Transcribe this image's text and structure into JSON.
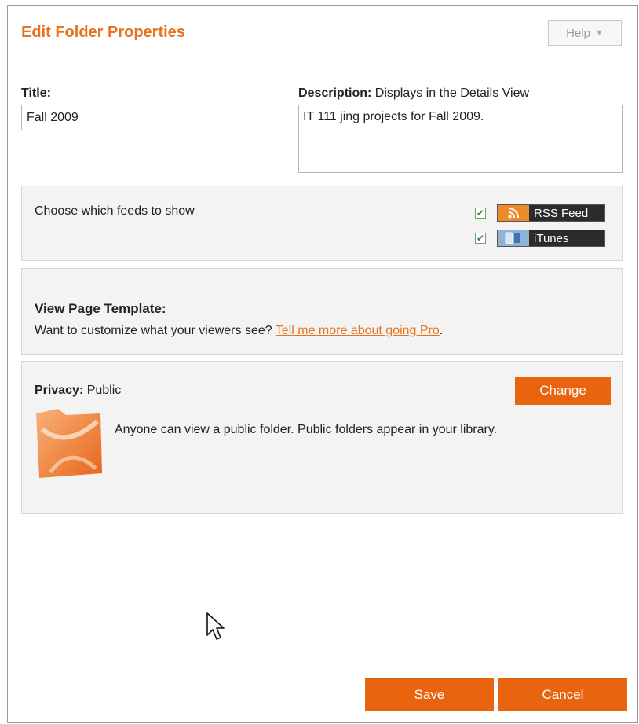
{
  "dialog": {
    "title": "Edit Folder Properties",
    "help_label": "Help"
  },
  "form": {
    "title_label": "Title:",
    "title_value": "Fall 2009",
    "description_label": "Description:",
    "description_hint": " Displays in the Details View",
    "description_value": "IT 111 jing projects for Fall 2009."
  },
  "feeds": {
    "prompt": "Choose which feeds to show",
    "items": [
      {
        "label": "RSS Feed",
        "checked": true,
        "icon": "rss-icon"
      },
      {
        "label": "iTunes",
        "checked": true,
        "icon": "itunes-icon"
      }
    ]
  },
  "template": {
    "heading": "View Page Template:",
    "text": "Want to customize what your viewers see? ",
    "link": "Tell me more about going Pro",
    "suffix": "."
  },
  "privacy": {
    "label": "Privacy:",
    "value": " Public",
    "change_label": "Change",
    "description": "Anyone can view a public folder. Public folders appear in your library."
  },
  "footer": {
    "save_label": "Save",
    "cancel_label": "Cancel"
  },
  "colors": {
    "accent": "#e8731f",
    "button": "#e8640f"
  }
}
